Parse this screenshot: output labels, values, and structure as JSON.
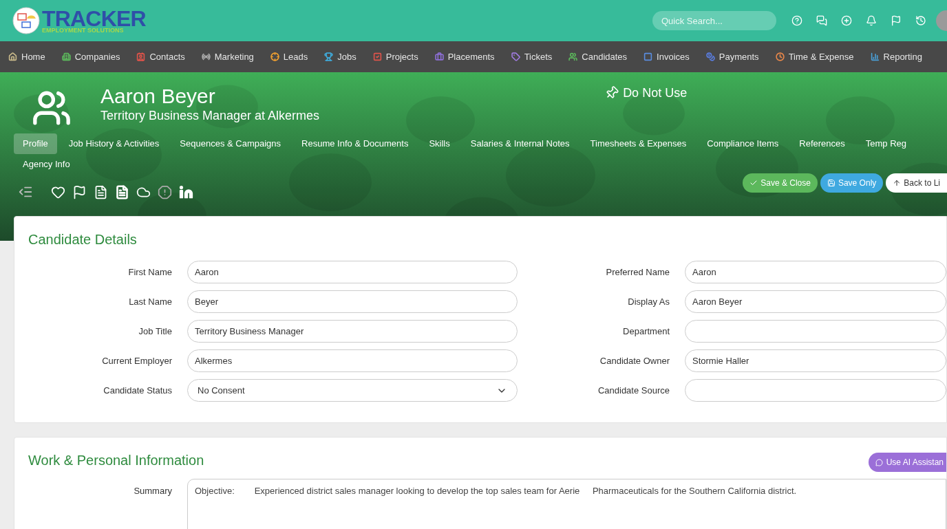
{
  "logo": {
    "name": "TRACKER",
    "tagline": "EMPLOYMENT SOLUTIONS"
  },
  "search": {
    "placeholder": "Quick Search..."
  },
  "nav": [
    {
      "label": "Home",
      "color": "#c9b98a"
    },
    {
      "label": "Companies",
      "color": "#5cb85c"
    },
    {
      "label": "Contacts",
      "color": "#e0534a"
    },
    {
      "label": "Marketing",
      "color": "#b0b0b0"
    },
    {
      "label": "Leads",
      "color": "#f0a030"
    },
    {
      "label": "Jobs",
      "color": "#3fa9d9"
    },
    {
      "label": "Projects",
      "color": "#e0534a"
    },
    {
      "label": "Placements",
      "color": "#8e6fd8"
    },
    {
      "label": "Tickets",
      "color": "#a07be0"
    },
    {
      "label": "Candidates",
      "color": "#5cb85c"
    },
    {
      "label": "Invoices",
      "color": "#5a8de0"
    },
    {
      "label": "Payments",
      "color": "#5a7de0"
    },
    {
      "label": "Time & Expense",
      "color": "#e8874a"
    },
    {
      "label": "Reporting",
      "color": "#4aa0d8"
    }
  ],
  "profile": {
    "name": "Aaron Beyer",
    "subtitle": "Territory Business Manager at Alkermes",
    "flag": "Do Not Use"
  },
  "tabs": [
    {
      "label": "Profile",
      "selected": true
    },
    {
      "label": "Job History & Activities",
      "selected": false
    },
    {
      "label": "Sequences & Campaigns",
      "selected": false
    },
    {
      "label": "Resume Info & Documents",
      "selected": false
    },
    {
      "label": "Skills",
      "selected": false
    },
    {
      "label": "Salaries & Internal Notes",
      "selected": false
    },
    {
      "label": "Timesheets & Expenses",
      "selected": false
    },
    {
      "label": "Compliance Items",
      "selected": false
    },
    {
      "label": "References",
      "selected": false
    },
    {
      "label": "Temp Reg",
      "selected": false
    },
    {
      "label": "Agency Info",
      "selected": false
    }
  ],
  "actions": [
    {
      "label": "Save & Close",
      "kind": "save-close"
    },
    {
      "label": "Save Only",
      "kind": "save"
    },
    {
      "label": "Back to Li",
      "kind": "back"
    }
  ],
  "candidate_details": {
    "title": "Candidate Details",
    "left": [
      {
        "label": "First Name",
        "value": "Aaron",
        "kind": "text"
      },
      {
        "label": "Last Name",
        "value": "Beyer",
        "kind": "text"
      },
      {
        "label": "Job Title",
        "value": "Territory Business Manager",
        "kind": "text"
      },
      {
        "label": "Current Employer",
        "value": "Alkermes",
        "kind": "text"
      },
      {
        "label": "Candidate Status",
        "value": "No Consent",
        "kind": "select"
      }
    ],
    "right": [
      {
        "label": "Preferred Name",
        "value": "Aaron",
        "kind": "text"
      },
      {
        "label": "Display As",
        "value": "Aaron Beyer",
        "kind": "text"
      },
      {
        "label": "Department",
        "kind": "text"
      },
      {
        "label": "Candidate Owner",
        "value": "Stormie Haller",
        "kind": "text"
      },
      {
        "label": "Candidate Source",
        "kind": "text"
      }
    ]
  },
  "work_info": {
    "title": "Work & Personal Information",
    "ai_button": "Use AI Assistan",
    "summary_label": "Summary",
    "summary": "Objective:\tExperienced district sales manager looking to develop the top sales team for Aerie\tPharmaceuticals for the Southern California district."
  }
}
